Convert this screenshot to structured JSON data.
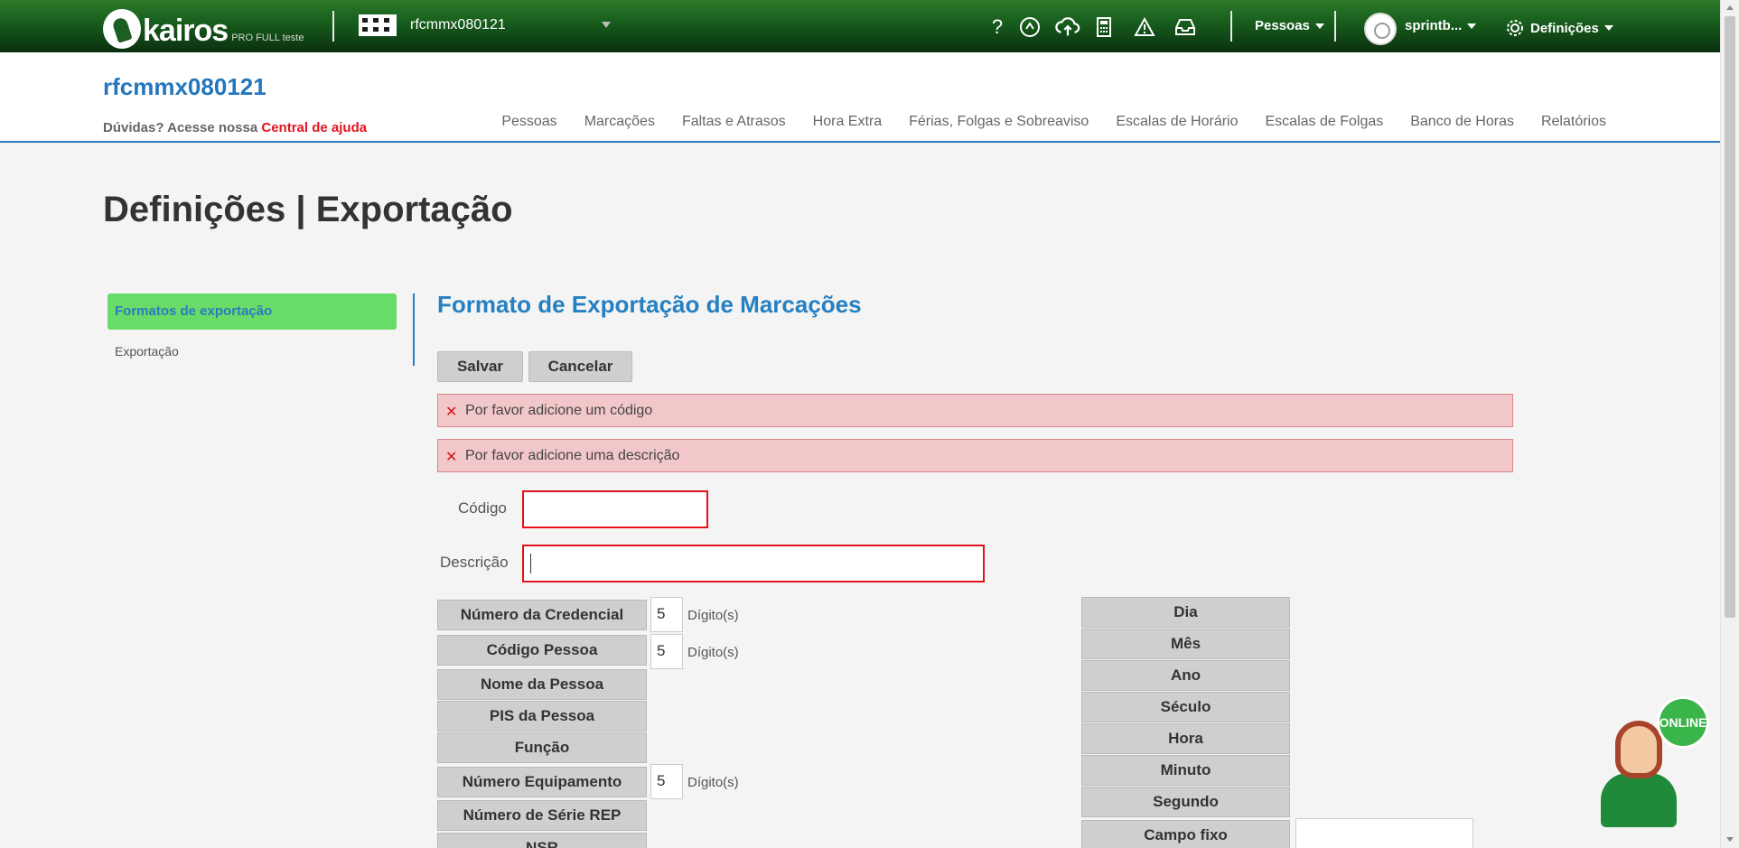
{
  "topbar": {
    "logo_text": "kairos",
    "logo_sub": "PRO FULL teste",
    "company": "rfcmmx080121",
    "icons": [
      "help-icon",
      "support-icon",
      "cloud-upload-icon",
      "calculator-icon",
      "warning-icon",
      "inbox-icon"
    ],
    "help_glyph": "?",
    "people_menu": "Pessoas",
    "user_menu": "sprintb...",
    "settings_menu": "Definições"
  },
  "header": {
    "title": "rfcmmx080121",
    "help_prefix": "Dúvidas? Acesse nossa",
    "help_link": "Central de ajuda",
    "nav": [
      "Pessoas",
      "Marcações",
      "Faltas e Atrasos",
      "Hora Extra",
      "Férias, Folgas e Sobreaviso",
      "Escalas de Horário",
      "Escalas de Folgas",
      "Banco de Horas",
      "Relatórios"
    ]
  },
  "page": {
    "title": "Definições | Exportação",
    "sidebar": [
      {
        "label": "Formatos de exportação",
        "active": true
      },
      {
        "label": "Exportação",
        "active": false
      }
    ],
    "section_title": "Formato de Exportação de Marcações",
    "save_label": "Salvar",
    "cancel_label": "Cancelar",
    "alerts": [
      "Por favor adicione um código",
      "Por favor adicione uma descrição"
    ],
    "code_label": "Código",
    "code_value": "",
    "description_label": "Descrição",
    "description_value": "",
    "digits_suffix": "Dígito(s)",
    "left_fields": [
      {
        "label": "Número da Credencial",
        "digits": "5"
      },
      {
        "label": "Código Pessoa",
        "digits": "5"
      },
      {
        "label": "Nome da Pessoa"
      },
      {
        "label": "PIS da Pessoa"
      },
      {
        "label": "Função"
      },
      {
        "label": "Número Equipamento",
        "digits": "5"
      },
      {
        "label": "Número de Série REP"
      },
      {
        "label": "NSR"
      }
    ],
    "right_fields": [
      "Dia",
      "Mês",
      "Ano",
      "Século",
      "Hora",
      "Minuto",
      "Segundo",
      "Campo fixo"
    ]
  },
  "support": {
    "badge": "ONLINE"
  },
  "colors": {
    "accent": "#2580c2",
    "active_green": "#67dc66",
    "error_red": "#e5121c",
    "alert_bg": "#f2c7c9"
  }
}
